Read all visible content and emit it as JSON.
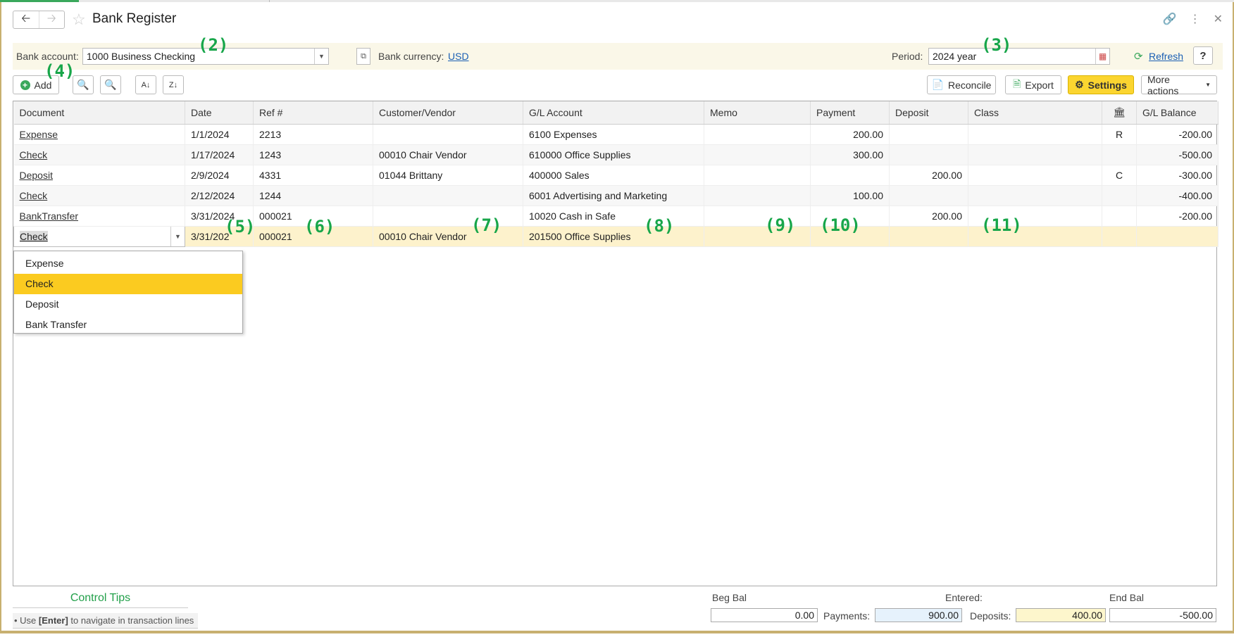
{
  "window": {
    "title": "Bank Register"
  },
  "filter": {
    "bank_account_label": "Bank account:",
    "bank_account_value": "1000 Business Checking",
    "bank_currency_label": "Bank currency:",
    "bank_currency_value": "USD",
    "period_label": "Period:",
    "period_value": "2024 year",
    "refresh_label": "Refresh",
    "help_label": "?"
  },
  "toolbar": {
    "add_label": "Add",
    "reconcile_label": "Reconcile",
    "export_label": "Export",
    "settings_label": "Settings",
    "more_actions_label": "More actions"
  },
  "columns": [
    "Document",
    "Date",
    "Ref #",
    "Customer/Vendor",
    "G/L Account",
    "Memo",
    "Payment",
    "Deposit",
    "Class",
    "",
    "G/L Balance"
  ],
  "rows": [
    {
      "document": "Expense",
      "date": "1/1/2024",
      "ref": "2213",
      "customer": "",
      "account": "6100 Expenses",
      "memo": "",
      "payment": "200.00",
      "deposit": "",
      "class": "",
      "status": "R",
      "balance": "-200.00"
    },
    {
      "document": "Check",
      "date": "1/17/2024",
      "ref": "1243",
      "customer": "00010 Chair Vendor",
      "account": "610000 Office Supplies",
      "memo": "",
      "payment": "300.00",
      "deposit": "",
      "class": "",
      "status": "",
      "balance": "-500.00"
    },
    {
      "document": "Deposit",
      "date": "2/9/2024",
      "ref": "4331",
      "customer": "01044 Brittany",
      "account": "400000 Sales",
      "memo": "",
      "payment": "",
      "deposit": "200.00",
      "class": "",
      "status": "C",
      "balance": "-300.00"
    },
    {
      "document": "Check",
      "date": "2/12/2024",
      "ref": "1244",
      "customer": "",
      "account": "6001 Advertising and Marketing",
      "memo": "",
      "payment": "100.00",
      "deposit": "",
      "class": "",
      "status": "",
      "balance": "-400.00"
    },
    {
      "document": "BankTransfer",
      "date": "3/31/2024",
      "ref": "000021",
      "customer": "",
      "account": "10020 Cash in Safe",
      "memo": "",
      "payment": "",
      "deposit": "200.00",
      "class": "",
      "status": "",
      "balance": "-200.00"
    },
    {
      "document": "Check",
      "date": "3/31/202",
      "ref": "000021",
      "customer": "00010 Chair Vendor",
      "account": "201500 Office Supplies",
      "memo": "",
      "payment": "",
      "deposit": "",
      "class": "",
      "status": "",
      "balance": ""
    }
  ],
  "dropdown": {
    "options": [
      "Expense",
      "Check",
      "Deposit",
      "Bank Transfer"
    ],
    "selected": "Check"
  },
  "annotations": [
    "(2)",
    "(3)",
    "(4)",
    "(5)",
    "(6)",
    "(7)",
    "(8)",
    "(9)",
    "(10)",
    "(11)"
  ],
  "footer": {
    "tips_title": "Control Tips",
    "tips_prefix": "• Use ",
    "tips_key": "[Enter]",
    "tips_suffix": " to navigate in transaction lines",
    "beg_bal_label": "Beg Bal",
    "beg_bal_value": "0.00",
    "entered_label": "Entered:",
    "payments_label": "Payments:",
    "payments_value": "900.00",
    "deposits_label": "Deposits:",
    "deposits_value": "400.00",
    "end_bal_label": "End Bal",
    "end_bal_value": "-500.00"
  },
  "icons": {
    "status_column": "bank-icon",
    "nav_back": "arrow-left-icon",
    "nav_forward": "arrow-right-icon",
    "favorite": "star-icon",
    "link": "link-icon",
    "kebab": "more-vertical-icon",
    "close": "close-icon"
  },
  "colors": {
    "accent_yellow": "#fbd530",
    "selected_row": "#fdf2cc",
    "annotation_green": "#18a64a",
    "link_blue": "#1a5fb4"
  }
}
